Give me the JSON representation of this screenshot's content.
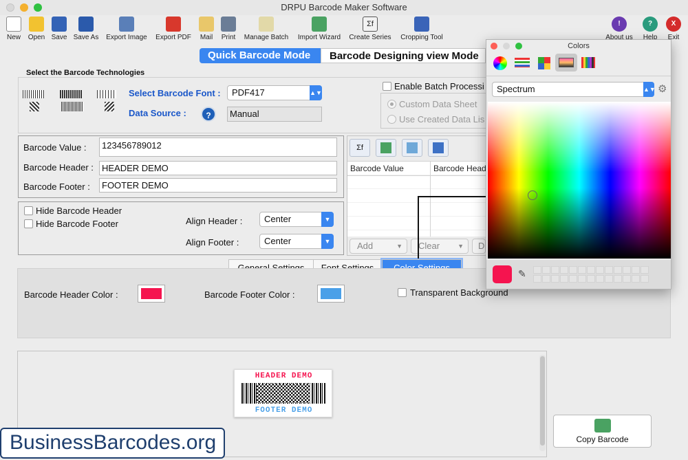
{
  "window": {
    "title": "DRPU Barcode Maker Software"
  },
  "toolbar": [
    {
      "label": "New",
      "icon": "new-file-icon"
    },
    {
      "label": "Open",
      "icon": "open-folder-icon"
    },
    {
      "label": "Save",
      "icon": "save-icon"
    },
    {
      "label": "Save As",
      "icon": "save-as-icon"
    },
    {
      "label": "Export Image",
      "icon": "export-image-icon"
    },
    {
      "label": "Export PDF",
      "icon": "pdf-icon"
    },
    {
      "label": "Mail",
      "icon": "mail-icon"
    },
    {
      "label": "Print",
      "icon": "printer-icon"
    },
    {
      "label": "Manage Batch",
      "icon": "manage-batch-icon"
    },
    {
      "label": "Import Wizard",
      "icon": "import-wizard-icon"
    },
    {
      "label": "Create Series",
      "icon": "series-icon"
    },
    {
      "label": "Cropping Tool",
      "icon": "crop-icon"
    },
    {
      "label": "About us",
      "icon": "about-icon"
    },
    {
      "label": "Help",
      "icon": "help-icon"
    },
    {
      "label": "Exit",
      "icon": "exit-icon"
    }
  ],
  "modes": {
    "quick": "Quick Barcode Mode",
    "design": "Barcode Designing view Mode"
  },
  "technologies": {
    "section_title": "Select the Barcode Technologies",
    "font_label": "Select Barcode Font :",
    "font_value": "PDF417",
    "source_label": "Data Source :",
    "source_value": "Manual",
    "batch_label": "Enable Batch Processi",
    "custom_sheet": "Custom Data Sheet",
    "created_list": "Use Created Data Lis"
  },
  "values": {
    "value_label": "Barcode Value :",
    "value": "123456789012",
    "header_label": "Barcode Header :",
    "header": "HEADER DEMO",
    "footer_label": "Barcode Footer :",
    "footer": "FOOTER DEMO"
  },
  "grid": {
    "col1": "Barcode Value",
    "col2": "Barcode Heade",
    "add": "Add",
    "clear": "Clear",
    "d": "D"
  },
  "align": {
    "hide_header": "Hide Barcode Header",
    "hide_footer": "Hide Barcode Footer",
    "header_label": "Align Header :",
    "header_value": "Center",
    "footer_label": "Align Footer :",
    "footer_value": "Center"
  },
  "tabs": {
    "general": "General Settings",
    "font": "Font Settings",
    "color": "Color Settings"
  },
  "color_settings": {
    "header_color_label": "Barcode Header Color :",
    "header_color": "#f5144f",
    "footer_color_label": "Barcode Footer Color :",
    "footer_color": "#4aa0e8",
    "transparent_label": "Transparent Background"
  },
  "preview": {
    "header": "HEADER DEMO",
    "footer": "FOOTER DEMO"
  },
  "copy": {
    "label": "Copy Barcode"
  },
  "watermark": "BusinessBarcodes.org",
  "colors_panel": {
    "title": "Colors",
    "mode": "Spectrum",
    "current": "#f5144f"
  }
}
